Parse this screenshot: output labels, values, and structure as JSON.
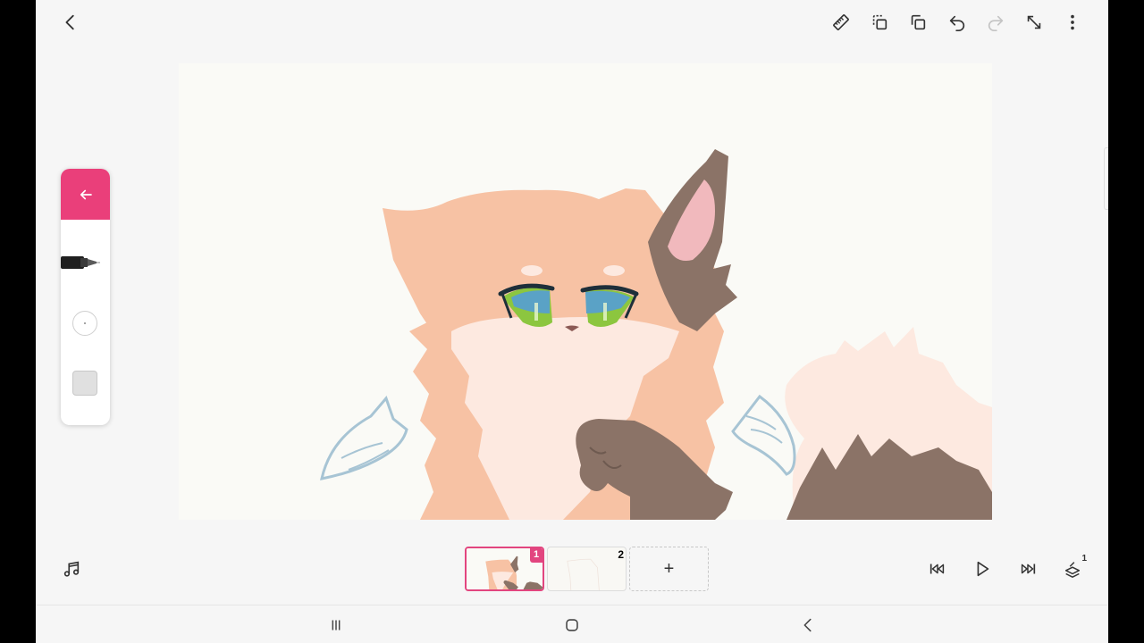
{
  "toolbar": {
    "icons": [
      "back-icon",
      "ruler-icon",
      "layer-copy-icon",
      "duplicate-icon",
      "undo-icon",
      "redo-icon",
      "fullscreen-icon",
      "more-icon"
    ]
  },
  "tool_panel": {
    "active_tool": "pen",
    "accent_color": "#ea3f7a",
    "selected_color": "#e0e0e0"
  },
  "timeline": {
    "frames": [
      {
        "number": "1",
        "selected": true
      },
      {
        "number": "2",
        "selected": false
      }
    ],
    "add_label": "+"
  },
  "playback": {
    "icons": [
      "music-icon",
      "skip-to-start-icon",
      "play-icon",
      "skip-to-end-icon",
      "onion-skin-icon"
    ],
    "onion_skin_count": "1"
  },
  "colors": {
    "fur_orange": "#f7c2a4",
    "fur_cream": "#fde9e0",
    "fur_brown": "#8b7367",
    "eye_green": "#8cc63f",
    "eye_blue": "#5aa2c6",
    "wing_outline": "#a7c4d4"
  }
}
